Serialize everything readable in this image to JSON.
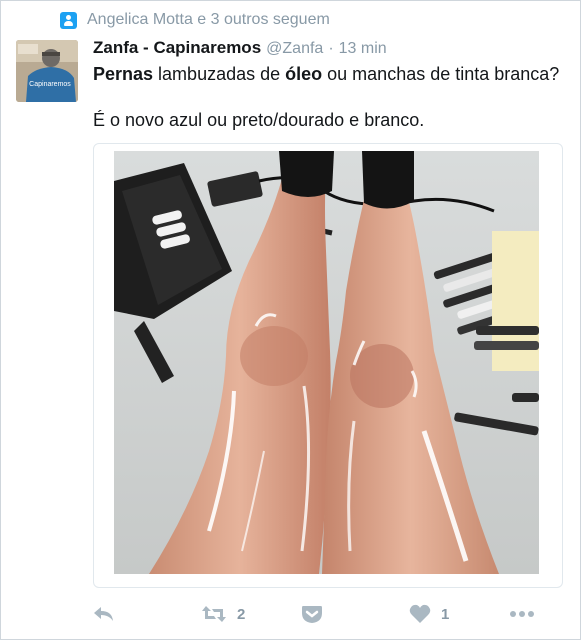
{
  "context": {
    "text": "Angelica Motta e 3 outros seguem",
    "icon": "follow-user-icon"
  },
  "tweet": {
    "author_name": "Zanfa - Capinaremos",
    "handle": "@Zanfa",
    "separator": "·",
    "time": "13 min",
    "line1": {
      "bold1": "Pernas",
      "text1": " lambuzadas de ",
      "bold2": "óleo",
      "text2": " ou manchas de tinta branca?"
    },
    "line2": "É o novo azul ou preto/dourado e branco.",
    "avatar_text": "Capinaremos"
  },
  "actions": {
    "reply_icon": "reply-icon",
    "retweet_icon": "retweet-icon",
    "retweet_count": "2",
    "save_icon": "pocket-save-icon",
    "like_icon": "heart-icon",
    "like_count": "1",
    "more_icon": "more-dots-icon"
  },
  "colors": {
    "accent": "#1da1f2",
    "muted": "#8899a6",
    "text": "#14171a",
    "icon": "#aab8c2"
  }
}
